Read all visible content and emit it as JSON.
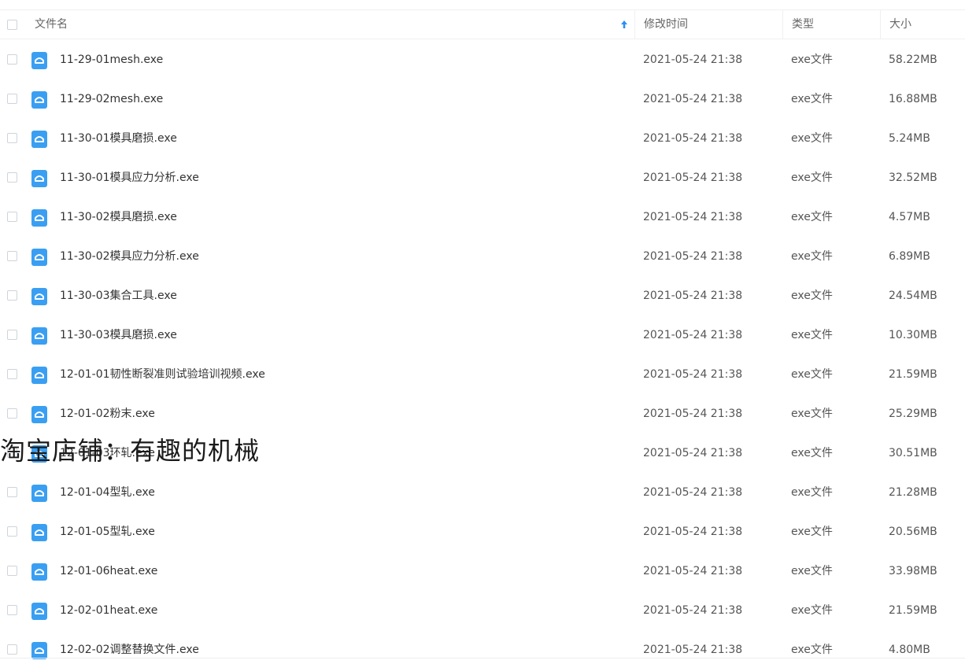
{
  "header": {
    "col_name": "文件名",
    "col_time": "修改时间",
    "col_type": "类型",
    "col_size": "大小"
  },
  "colors": {
    "icon_blue": "#3a9ff2",
    "sort_arrow": "#2f8df5"
  },
  "files": [
    {
      "name": "11-29-01mesh.exe",
      "time": "2021-05-24 21:38",
      "type": "exe文件",
      "size": "58.22MB"
    },
    {
      "name": "11-29-02mesh.exe",
      "time": "2021-05-24 21:38",
      "type": "exe文件",
      "size": "16.88MB"
    },
    {
      "name": "11-30-01模具磨损.exe",
      "time": "2021-05-24 21:38",
      "type": "exe文件",
      "size": "5.24MB"
    },
    {
      "name": "11-30-01模具应力分析.exe",
      "time": "2021-05-24 21:38",
      "type": "exe文件",
      "size": "32.52MB"
    },
    {
      "name": "11-30-02模具磨损.exe",
      "time": "2021-05-24 21:38",
      "type": "exe文件",
      "size": "4.57MB"
    },
    {
      "name": "11-30-02模具应力分析.exe",
      "time": "2021-05-24 21:38",
      "type": "exe文件",
      "size": "6.89MB"
    },
    {
      "name": "11-30-03集合工具.exe",
      "time": "2021-05-24 21:38",
      "type": "exe文件",
      "size": "24.54MB"
    },
    {
      "name": "11-30-03模具磨损.exe",
      "time": "2021-05-24 21:38",
      "type": "exe文件",
      "size": "10.30MB"
    },
    {
      "name": "12-01-01韧性断裂准则试验培训视频.exe",
      "time": "2021-05-24 21:38",
      "type": "exe文件",
      "size": "21.59MB"
    },
    {
      "name": "12-01-02粉末.exe",
      "time": "2021-05-24 21:38",
      "type": "exe文件",
      "size": "25.29MB"
    },
    {
      "name": "12-01-03环轧.exe",
      "time": "2021-05-24 21:38",
      "type": "exe文件",
      "size": "30.51MB"
    },
    {
      "name": "12-01-04型轧.exe",
      "time": "2021-05-24 21:38",
      "type": "exe文件",
      "size": "21.28MB"
    },
    {
      "name": "12-01-05型轧.exe",
      "time": "2021-05-24 21:38",
      "type": "exe文件",
      "size": "20.56MB"
    },
    {
      "name": "12-01-06heat.exe",
      "time": "2021-05-24 21:38",
      "type": "exe文件",
      "size": "33.98MB"
    },
    {
      "name": "12-02-01heat.exe",
      "time": "2021-05-24 21:38",
      "type": "exe文件",
      "size": "21.59MB"
    },
    {
      "name": "12-02-02调整替换文件.exe",
      "time": "2021-05-24 21:38",
      "type": "exe文件",
      "size": "4.80MB"
    }
  ],
  "watermark": "淘宝店铺：有趣的机械"
}
